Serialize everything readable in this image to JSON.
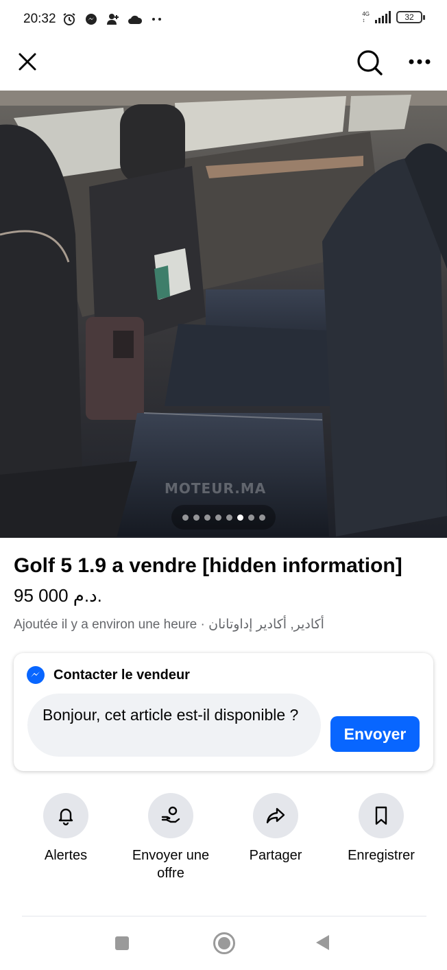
{
  "status_bar": {
    "time": "20:32",
    "network": "4G",
    "battery": "32",
    "left_icons": [
      "alarm-icon",
      "messenger-icon",
      "person-icon",
      "cloud-icon",
      "more-dots-icon"
    ]
  },
  "app_bar": {
    "icons": [
      "close-icon",
      "search-icon",
      "more-horizontal-icon"
    ]
  },
  "photo": {
    "watermark": "MOTEUR.MA",
    "page_count": 8,
    "active_index": 5
  },
  "listing": {
    "title": "Golf 5 1.9 a vendre [hidden information]",
    "price": "95 000 د.م.",
    "meta": "Ajoutée il y a environ une heure · أكادير, أكادير إداوتانان"
  },
  "contact": {
    "title": "Contacter le vendeur",
    "message": "Bonjour, cet article est-il disponible ?",
    "send_label": "Envoyer"
  },
  "actions": [
    {
      "label": "Alertes",
      "icon": "bell-icon"
    },
    {
      "label": "Envoyer une offre",
      "icon": "offer-hand-icon"
    },
    {
      "label": "Partager",
      "icon": "share-arrow-icon"
    },
    {
      "label": "Enregistrer",
      "icon": "bookmark-icon"
    }
  ],
  "colors": {
    "accent": "#0866ff",
    "secondary_text": "#65676b",
    "action_circle": "#e4e6eb",
    "input_background": "#f0f2f5"
  }
}
